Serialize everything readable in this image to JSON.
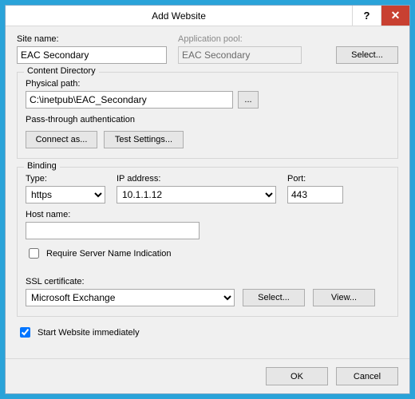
{
  "window": {
    "title": "Add Website"
  },
  "top": {
    "site_name_label": "Site name:",
    "site_name_value": "EAC Secondary",
    "app_pool_label": "Application pool:",
    "app_pool_value": "EAC Secondary",
    "select_label": "Select..."
  },
  "content_dir": {
    "legend": "Content Directory",
    "path_label": "Physical path:",
    "path_value": "C:\\inetpub\\EAC_Secondary",
    "browse_label": "...",
    "passthrough_label": "Pass-through authentication",
    "connect_as_label": "Connect as...",
    "test_settings_label": "Test Settings..."
  },
  "binding": {
    "legend": "Binding",
    "type_label": "Type:",
    "type_value": "https",
    "ip_label": "IP address:",
    "ip_value": "10.1.1.12",
    "port_label": "Port:",
    "port_value": "443",
    "host_label": "Host name:",
    "host_value": "",
    "sni_label": "Require Server Name Indication",
    "cert_label": "SSL certificate:",
    "cert_value": "Microsoft Exchange",
    "cert_select_label": "Select...",
    "cert_view_label": "View..."
  },
  "start_immediately_label": "Start Website immediately",
  "footer": {
    "ok": "OK",
    "cancel": "Cancel"
  }
}
